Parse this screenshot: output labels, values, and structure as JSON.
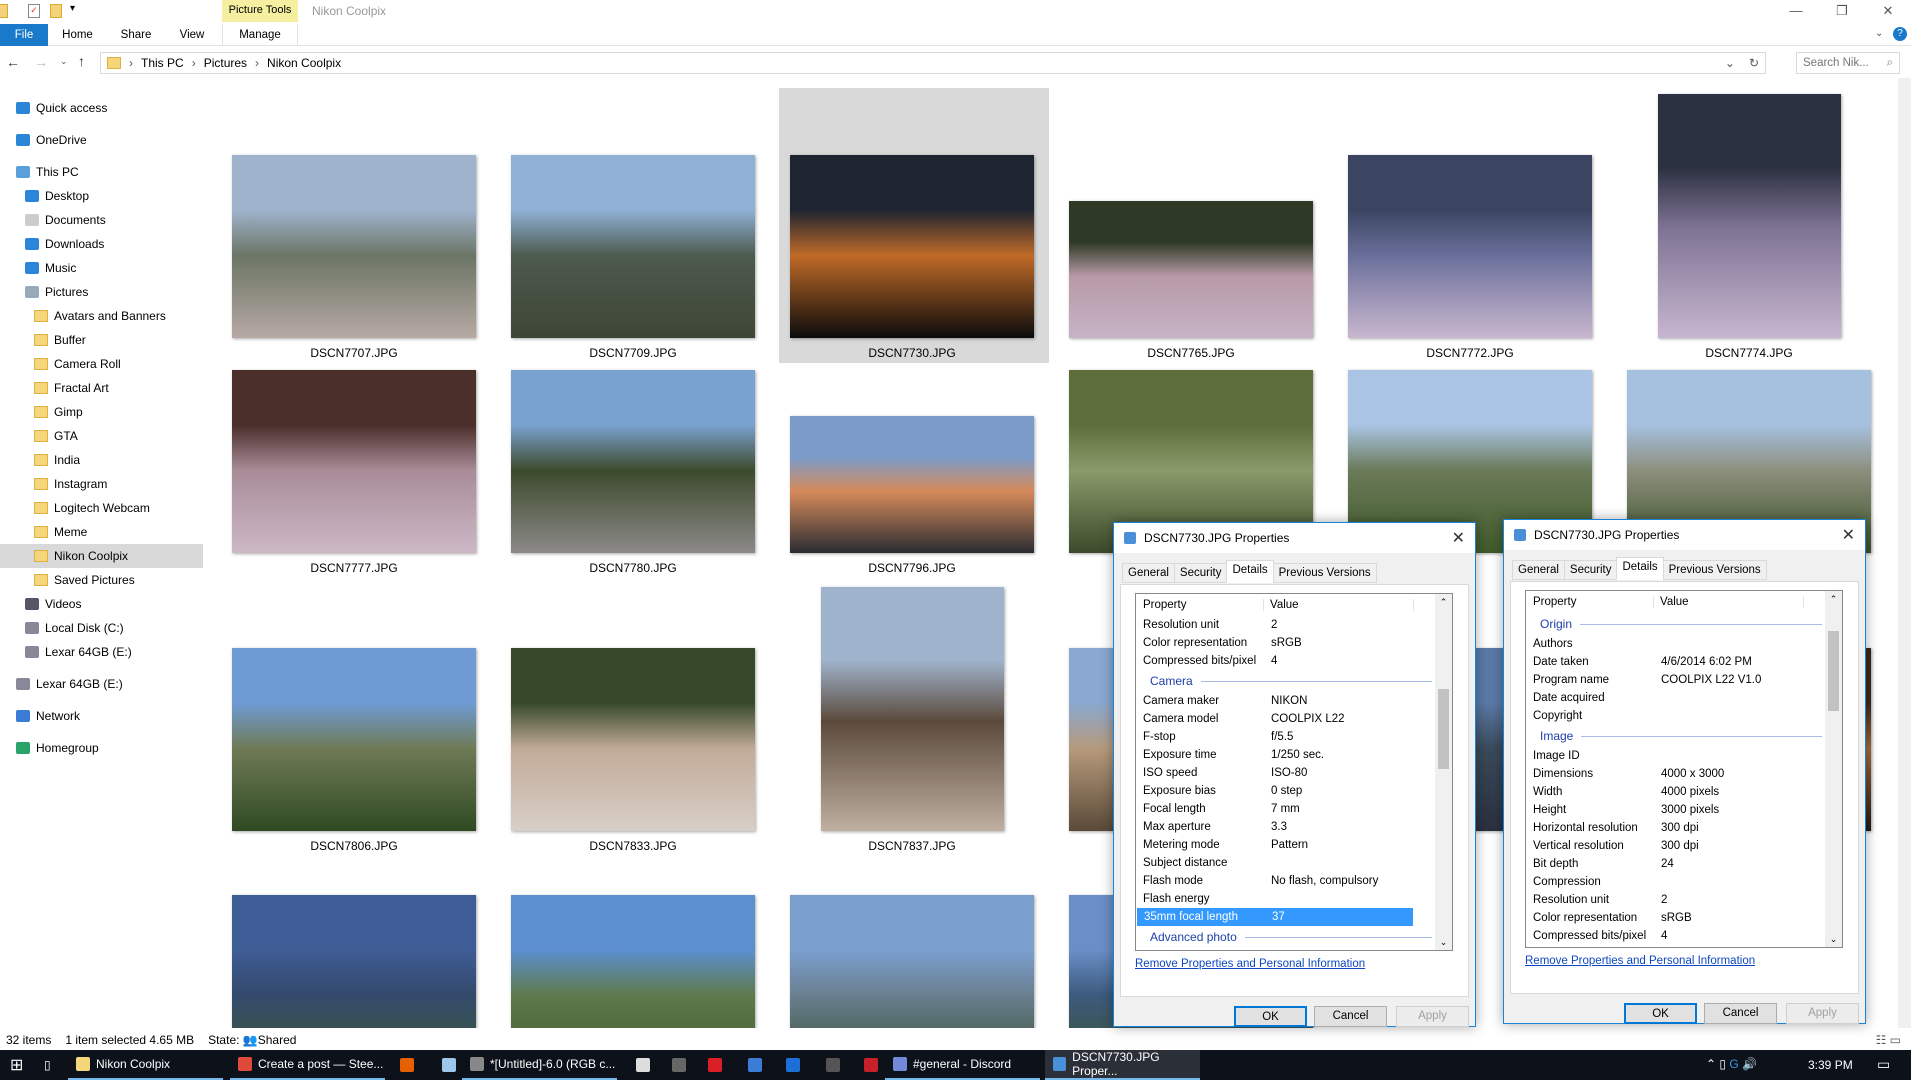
{
  "window": {
    "title": "Nikon Coolpix",
    "context_tab": "Picture Tools"
  },
  "ribbon": {
    "tabs": [
      "File",
      "Home",
      "Share",
      "View",
      "Manage"
    ]
  },
  "address": {
    "crumbs": [
      "This PC",
      "Pictures",
      "Nikon Coolpix"
    ],
    "search_placeholder": "Search Nik..."
  },
  "sidebar": {
    "items": [
      {
        "label": "Quick access",
        "icon": "star-icon",
        "level": 0,
        "gap": 0
      },
      {
        "label": "OneDrive",
        "icon": "cloud-icon",
        "level": 0,
        "gap": 1
      },
      {
        "label": "This PC",
        "icon": "computer-icon",
        "level": 0,
        "gap": 1
      },
      {
        "label": "Desktop",
        "icon": "desktop-icon",
        "level": 1
      },
      {
        "label": "Documents",
        "icon": "documents-icon",
        "level": 1
      },
      {
        "label": "Downloads",
        "icon": "download-icon",
        "level": 1
      },
      {
        "label": "Music",
        "icon": "music-icon",
        "level": 1
      },
      {
        "label": "Pictures",
        "icon": "pictures-icon",
        "level": 1
      },
      {
        "label": "Avatars and Banners",
        "icon": "folder-icon",
        "level": 2
      },
      {
        "label": "Buffer",
        "icon": "folder-icon",
        "level": 2
      },
      {
        "label": "Camera Roll",
        "icon": "folder-icon",
        "level": 2
      },
      {
        "label": "Fractal Art",
        "icon": "folder-icon",
        "level": 2
      },
      {
        "label": "Gimp",
        "icon": "folder-icon",
        "level": 2
      },
      {
        "label": "GTA",
        "icon": "folder-icon",
        "level": 2
      },
      {
        "label": "India",
        "icon": "folder-icon",
        "level": 2
      },
      {
        "label": "Instagram",
        "icon": "folder-icon",
        "level": 2
      },
      {
        "label": "Logitech Webcam",
        "icon": "folder-icon",
        "level": 2
      },
      {
        "label": "Meme",
        "icon": "folder-icon",
        "level": 2
      },
      {
        "label": "Nikon Coolpix",
        "icon": "folder-icon",
        "level": 2,
        "selected": true
      },
      {
        "label": "Saved Pictures",
        "icon": "folder-icon",
        "level": 2
      },
      {
        "label": "Videos",
        "icon": "videos-icon",
        "level": 1
      },
      {
        "label": "Local Disk (C:)",
        "icon": "drive-icon",
        "level": 1
      },
      {
        "label": "Lexar 64GB (E:)",
        "icon": "drive-icon",
        "level": 1
      },
      {
        "label": "Lexar 64GB (E:)",
        "icon": "drive-icon",
        "level": 0,
        "gap": 1
      },
      {
        "label": "Network",
        "icon": "network-icon",
        "level": 0,
        "gap": 1
      },
      {
        "label": "Homegroup",
        "icon": "homegroup-icon",
        "level": 0,
        "gap": 1
      }
    ]
  },
  "files": [
    {
      "name": "DSCN7707.JPG",
      "shape": "land",
      "c": [
        "#9fb3cc",
        "#6b7566",
        "#b7a9a4"
      ]
    },
    {
      "name": "DSCN7709.JPG",
      "shape": "land",
      "c": [
        "#8fb1d6",
        "#4d5a4e",
        "#3e4636"
      ]
    },
    {
      "name": "DSCN7730.JPG",
      "shape": "land",
      "c": [
        "#1e2430",
        "#c06a28",
        "#0b0b0b"
      ],
      "selected": true
    },
    {
      "name": "DSCN7765.JPG",
      "shape": "wide",
      "c": [
        "#2f3a26",
        "#b79aa7",
        "#c6b3c6"
      ]
    },
    {
      "name": "DSCN7772.JPG",
      "shape": "land",
      "c": [
        "#3b4562",
        "#6a6f9a",
        "#c9b7cf"
      ]
    },
    {
      "name": "DSCN7774.JPG",
      "shape": "port",
      "c": [
        "#2b3140",
        "#7f7394",
        "#c7b6cf"
      ]
    },
    {
      "name": "DSCN7777.JPG",
      "shape": "land",
      "c": [
        "#4a2f2a",
        "#a88c98",
        "#cdb8c6"
      ]
    },
    {
      "name": "DSCN7780.JPG",
      "shape": "land",
      "c": [
        "#7aa2d0",
        "#3c4a2c",
        "#8c8a88"
      ]
    },
    {
      "name": "DSCN7796.JPG",
      "shape": "wide",
      "c": [
        "#7b9bc9",
        "#d68a5a",
        "#2a2c32"
      ]
    },
    {
      "name": "",
      "shape": "land",
      "c": [
        "#5e6e3a",
        "#8a9a6a",
        "#3c4a2a"
      ]
    },
    {
      "name": "",
      "shape": "land",
      "c": [
        "#a9c4e4",
        "#6b7a58",
        "#3f5a2a"
      ]
    },
    {
      "name": "",
      "shape": "land",
      "c": [
        "#a6c0e0",
        "#8c8f7c",
        "#3a5128"
      ]
    },
    {
      "name": "DSCN7806.JPG",
      "shape": "land",
      "c": [
        "#6f9bd5",
        "#6f7a55",
        "#2f4a23"
      ]
    },
    {
      "name": "DSCN7833.JPG",
      "shape": "land",
      "c": [
        "#37492a",
        "#c2aa98",
        "#d8cfc8"
      ]
    },
    {
      "name": "DSCN7837.JPG",
      "shape": "port",
      "c": [
        "#9fb3cc",
        "#5b4a3c",
        "#c0b0a2"
      ]
    },
    {
      "name": "",
      "shape": "land",
      "c": [
        "#8aa8d0",
        "#b69a7c",
        "#5a4a38"
      ]
    },
    {
      "name": "",
      "shape": "land",
      "c": [
        "#5a7aa8",
        "#3a4a5a",
        "#2a3040"
      ]
    },
    {
      "name": "",
      "shape": "land",
      "c": [
        "#3a2a20",
        "#a06a3a",
        "#201a18"
      ]
    },
    {
      "name": "",
      "shape": "land",
      "c": [
        "#3e5c95",
        "#344a6c",
        "#3c5a2c"
      ]
    },
    {
      "name": "",
      "shape": "land",
      "c": [
        "#5c8fd0",
        "#5e7a4c",
        "#3e5a2c"
      ]
    },
    {
      "name": "",
      "shape": "land",
      "c": [
        "#7a9fcf",
        "#6a7f90",
        "#2f4a26"
      ]
    },
    {
      "name": "",
      "shape": "land",
      "c": [
        "#6a8fc8",
        "#3c5a7c",
        "#3a5028"
      ]
    }
  ],
  "status": {
    "count": "32 items",
    "selection": "1 item selected  4.65 MB",
    "state_label": "State:",
    "state_value": "Shared"
  },
  "dialogs": [
    {
      "title": "DSCN7730.JPG Properties",
      "tabs": [
        "General",
        "Security",
        "Details",
        "Previous Versions"
      ],
      "active_tab": "Details",
      "header": [
        "Property",
        "Value"
      ],
      "rows": [
        {
          "k": "Resolution unit",
          "v": "2"
        },
        {
          "k": "Color representation",
          "v": "sRGB"
        },
        {
          "k": "Compressed bits/pixel",
          "v": "4"
        },
        {
          "group": "Camera"
        },
        {
          "k": "Camera maker",
          "v": "NIKON"
        },
        {
          "k": "Camera model",
          "v": "COOLPIX L22"
        },
        {
          "k": "F-stop",
          "v": "f/5.5"
        },
        {
          "k": "Exposure time",
          "v": "1/250 sec."
        },
        {
          "k": "ISO speed",
          "v": "ISO-80"
        },
        {
          "k": "Exposure bias",
          "v": "0 step"
        },
        {
          "k": "Focal length",
          "v": "7 mm"
        },
        {
          "k": "Max aperture",
          "v": "3.3"
        },
        {
          "k": "Metering mode",
          "v": "Pattern"
        },
        {
          "k": "Subject distance",
          "v": ""
        },
        {
          "k": "Flash mode",
          "v": "No flash, compulsory"
        },
        {
          "k": "Flash energy",
          "v": ""
        },
        {
          "k": "35mm focal length",
          "v": "37",
          "selected": true
        },
        {
          "group": "Advanced photo"
        }
      ],
      "link": "Remove Properties and Personal Information",
      "buttons": [
        "OK",
        "Cancel",
        "Apply"
      ]
    },
    {
      "title": "DSCN7730.JPG Properties",
      "tabs": [
        "General",
        "Security",
        "Details",
        "Previous Versions"
      ],
      "active_tab": "Details",
      "header": [
        "Property",
        "Value"
      ],
      "rows": [
        {
          "group": "Origin"
        },
        {
          "k": "Authors",
          "v": ""
        },
        {
          "k": "Date taken",
          "v": "4/6/2014 6:02 PM"
        },
        {
          "k": "Program name",
          "v": "COOLPIX L22 V1.0"
        },
        {
          "k": "Date acquired",
          "v": ""
        },
        {
          "k": "Copyright",
          "v": ""
        },
        {
          "group": "Image"
        },
        {
          "k": "Image ID",
          "v": ""
        },
        {
          "k": "Dimensions",
          "v": "4000 x 3000"
        },
        {
          "k": "Width",
          "v": "4000 pixels"
        },
        {
          "k": "Height",
          "v": "3000 pixels"
        },
        {
          "k": "Horizontal resolution",
          "v": "300 dpi"
        },
        {
          "k": "Vertical resolution",
          "v": "300 dpi"
        },
        {
          "k": "Bit depth",
          "v": "24"
        },
        {
          "k": "Compression",
          "v": ""
        },
        {
          "k": "Resolution unit",
          "v": "2"
        },
        {
          "k": "Color representation",
          "v": "sRGB"
        },
        {
          "k": "Compressed bits/pixel",
          "v": "4"
        }
      ],
      "link": "Remove Properties and Personal Information",
      "buttons": [
        "OK",
        "Cancel",
        "Apply"
      ]
    }
  ],
  "taskbar": {
    "items": [
      {
        "label": "Nikon Coolpix",
        "icon": "folder-icon",
        "color": "#f6d67b"
      },
      {
        "label": "Create a post — Stee...",
        "icon": "chrome-icon",
        "color": "#e04a3a"
      },
      {
        "label": "",
        "icon": "firefox-icon",
        "color": "#e66000"
      },
      {
        "label": "",
        "icon": "notepad-icon",
        "color": "#9ec6ea"
      },
      {
        "label": "*[Untitled]-6.0 (RGB c...",
        "icon": "gimp-icon",
        "color": "#888"
      },
      {
        "label": "",
        "icon": "calculator-icon",
        "color": "#ddd"
      },
      {
        "label": "",
        "icon": "mouse-icon",
        "color": "#666"
      },
      {
        "label": "",
        "icon": "creative-cloud-icon",
        "color": "#da1f26"
      },
      {
        "label": "",
        "icon": "network-tool-icon",
        "color": "#3a7bd5"
      },
      {
        "label": "",
        "icon": "app-icon",
        "color": "#1c6fd6"
      },
      {
        "label": "",
        "icon": "obs-icon",
        "color": "#555"
      },
      {
        "label": "",
        "icon": "7zip-icon",
        "color": "#c8202a"
      },
      {
        "label": "#general - Discord",
        "icon": "discord-icon",
        "color": "#7289da"
      },
      {
        "label": "DSCN7730.JPG Proper...",
        "icon": "image-icon",
        "color": "#4a90d9"
      }
    ],
    "time": "3:39 PM"
  }
}
